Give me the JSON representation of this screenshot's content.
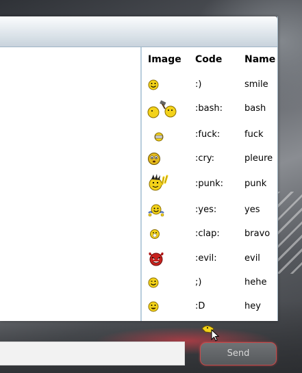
{
  "smiley_table": {
    "headers": {
      "image": "Image",
      "code": "Code",
      "name": "Name"
    },
    "rows": [
      {
        "code": ":)",
        "name": "smile",
        "icon": "smile-icon"
      },
      {
        "code": ":bash:",
        "name": "bash",
        "icon": "bash-icon"
      },
      {
        "code": ":fuck:",
        "name": "fuck",
        "icon": "fuck-icon"
      },
      {
        "code": ":cry:",
        "name": "pleure",
        "icon": "cry-icon"
      },
      {
        "code": ":punk:",
        "name": "punk",
        "icon": "punk-icon"
      },
      {
        "code": ":yes:",
        "name": "yes",
        "icon": "yes-icon"
      },
      {
        "code": ":clap:",
        "name": "bravo",
        "icon": "clap-icon"
      },
      {
        "code": ":evil:",
        "name": "evil",
        "icon": "evil-icon"
      },
      {
        "code": ";)",
        "name": "hehe",
        "icon": "wink-icon"
      },
      {
        "code": ":D",
        "name": "hey",
        "icon": "grin-icon"
      }
    ]
  },
  "composer": {
    "message_value": "",
    "send_label": "Send"
  },
  "colors": {
    "smiley_yellow": "#f3d21a",
    "send_border": "#c94b4b",
    "panel_divider": "#b8cddc"
  }
}
